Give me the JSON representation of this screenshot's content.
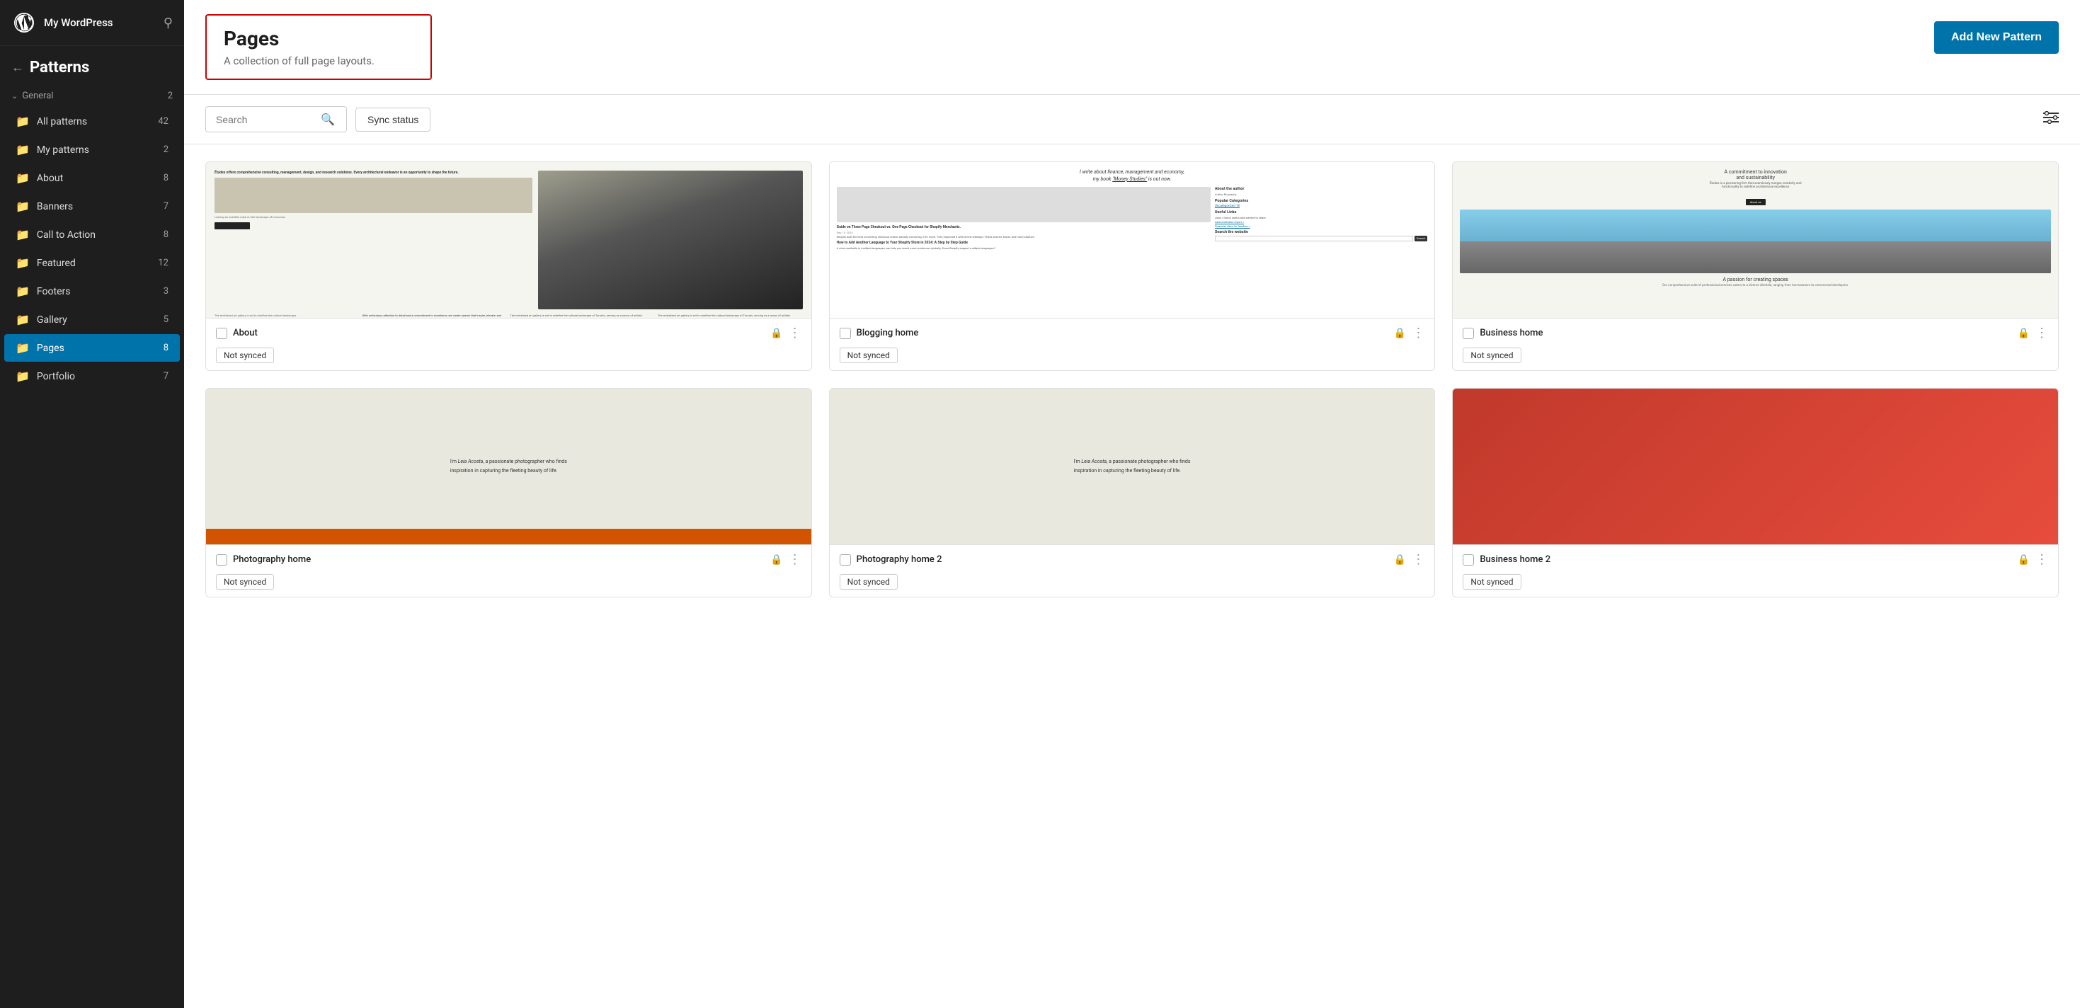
{
  "sidebar": {
    "site_name": "My WordPress",
    "back_label": "Patterns",
    "section_label": "General",
    "section_count": "2",
    "nav_items": [
      {
        "id": "all-patterns",
        "label": "All patterns",
        "count": "42",
        "active": false
      },
      {
        "id": "my-patterns",
        "label": "My patterns",
        "count": "2",
        "active": false
      },
      {
        "id": "about",
        "label": "About",
        "count": "8",
        "active": false
      },
      {
        "id": "banners",
        "label": "Banners",
        "count": "7",
        "active": false
      },
      {
        "id": "call-to-action",
        "label": "Call to Action",
        "count": "8",
        "active": false
      },
      {
        "id": "featured",
        "label": "Featured",
        "count": "12",
        "active": false
      },
      {
        "id": "footers",
        "label": "Footers",
        "count": "3",
        "active": false
      },
      {
        "id": "gallery",
        "label": "Gallery",
        "count": "5",
        "active": false
      },
      {
        "id": "pages",
        "label": "Pages",
        "count": "8",
        "active": true
      },
      {
        "id": "portfolio",
        "label": "Portfolio",
        "count": "7",
        "active": false
      }
    ]
  },
  "header": {
    "title": "Pages",
    "description": "A collection of full page layouts.",
    "add_button_label": "Add New Pattern"
  },
  "toolbar": {
    "search_placeholder": "Search",
    "sync_status_label": "Sync status"
  },
  "patterns": [
    {
      "id": "about",
      "name": "About",
      "sync_status": "Not synced",
      "locked": true,
      "preview_type": "about"
    },
    {
      "id": "blogging-home",
      "name": "Blogging home",
      "sync_status": "Not synced",
      "locked": true,
      "preview_type": "blog"
    },
    {
      "id": "business-home",
      "name": "Business home",
      "sync_status": "Not synced",
      "locked": true,
      "preview_type": "business"
    },
    {
      "id": "photo-1",
      "name": "Photography home",
      "sync_status": "Not synced",
      "locked": true,
      "preview_type": "photo"
    },
    {
      "id": "photo-2",
      "name": "Photography home 2",
      "sync_status": "Not synced",
      "locked": true,
      "preview_type": "photo"
    },
    {
      "id": "business-home-2",
      "name": "Business home 2",
      "sync_status": "Not synced",
      "locked": true,
      "preview_type": "business2"
    }
  ]
}
